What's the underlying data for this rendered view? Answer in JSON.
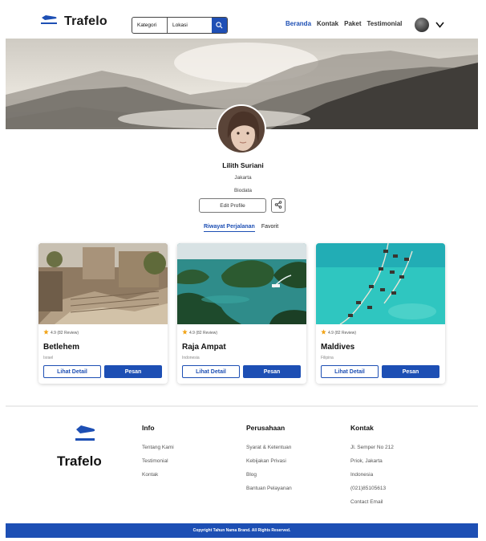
{
  "header": {
    "brand": "Trafelo",
    "search": {
      "category": "Kategori",
      "location": "Lokasi"
    },
    "nav": [
      "Beranda",
      "Kontak",
      "Paket",
      "Testimonial"
    ],
    "active_nav": "Beranda",
    "accent_color": "#1d4fb4"
  },
  "profile": {
    "name": "Lilith Suriani",
    "city": "Jakarta",
    "bio": "Biodata",
    "edit_label": "Edit Profile",
    "tabs": [
      "Riwayat Perjalanan",
      "Favorit"
    ]
  },
  "cards": [
    {
      "title": "Betlehem",
      "country": "Israel",
      "rating": "4.9 (82 Review)",
      "detail_label": "Lihat Detail",
      "book_label": "Pesan"
    },
    {
      "title": "Raja Ampat",
      "country": "Indonesia",
      "rating": "4.9 (82 Review)",
      "detail_label": "Lihat Detail",
      "book_label": "Pesan"
    },
    {
      "title": "Maldives",
      "country": "Filipina",
      "rating": "4.9 (82 Review)",
      "detail_label": "Lihat Detail",
      "book_label": "Pesan"
    }
  ],
  "footer": {
    "brand": "Trafelo",
    "info": {
      "heading": "Info",
      "links": [
        "Tentang Kami",
        "Testimonial",
        "Kontak"
      ]
    },
    "company": {
      "heading": "Perusahaan",
      "links": [
        "Syarat & Ketentuan",
        "Kebijakan Privasi",
        "Blog",
        "Bantuan Pelayanan"
      ]
    },
    "contact": {
      "heading": "Kontak",
      "links": [
        "Jl. Semper No 212",
        "Priok, Jakarta",
        "Indonesia",
        "(021)85105613",
        "Contact Email"
      ]
    },
    "copyright": "Copyright Tahun Nama Brand. All Rights Reserved."
  }
}
